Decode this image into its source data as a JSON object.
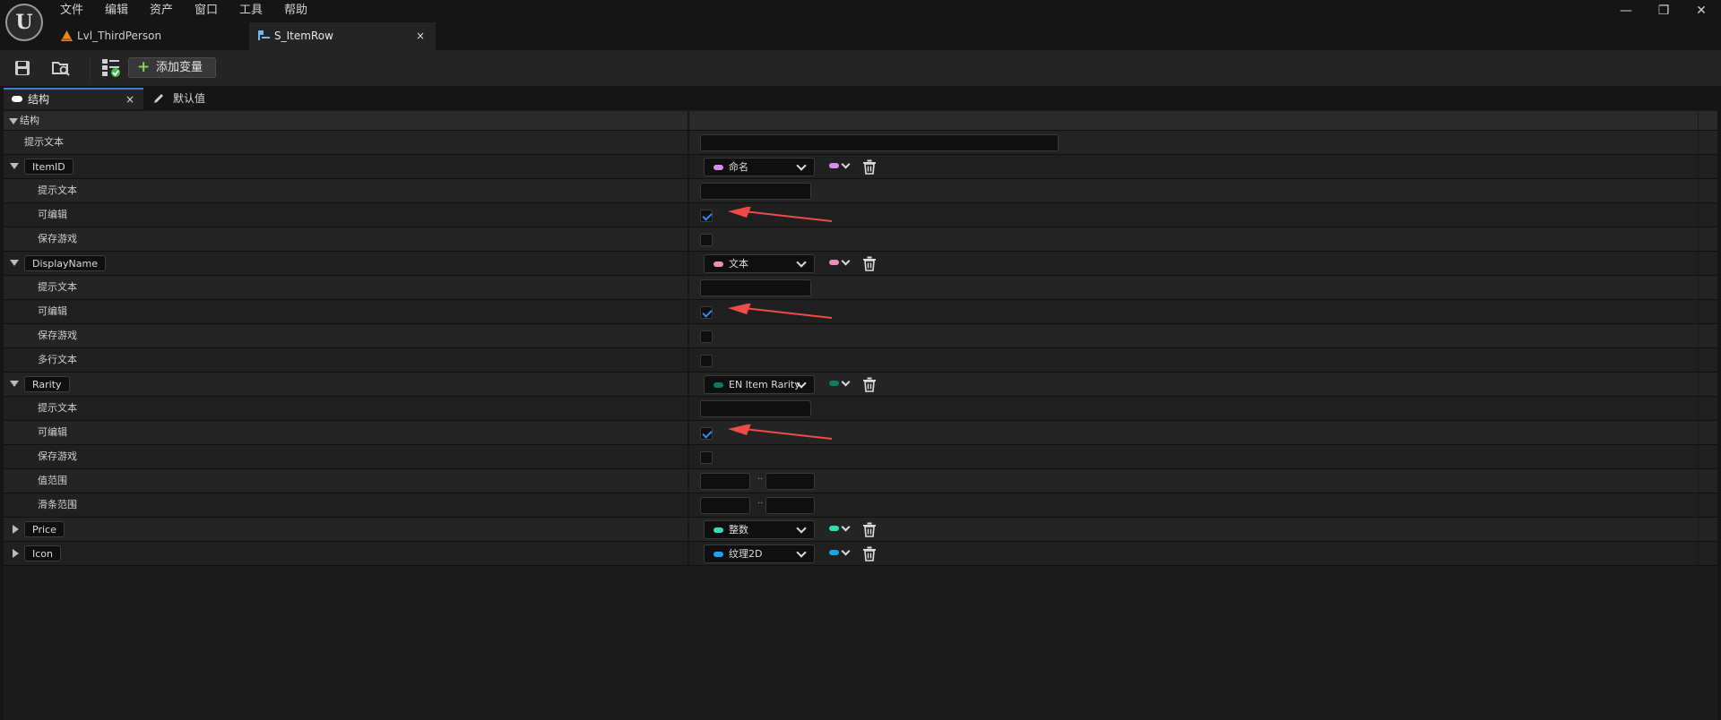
{
  "app": {
    "logo": "U"
  },
  "menu": [
    "文件",
    "编辑",
    "资产",
    "窗口",
    "工具",
    "帮助"
  ],
  "window_controls": {
    "minimize": "—",
    "restore": "❐",
    "close": "✕"
  },
  "doc_tabs": [
    {
      "label": "Lvl_ThirdPerson",
      "icon": "level-icon",
      "active": false
    },
    {
      "label": "S_ItemRow",
      "icon": "struct-icon",
      "active": true,
      "close": "×"
    }
  ],
  "toolbar": {
    "add_variable_label": "添加变量"
  },
  "panel_tabs": [
    {
      "label": "结构",
      "active": true,
      "close": "×"
    },
    {
      "label": "默认值",
      "active": false
    }
  ],
  "structure": {
    "section_label": "结构",
    "tooltip_label": "提示文本",
    "members": [
      {
        "name": "ItemID",
        "type": "命名",
        "color": "#d88ef0",
        "expanded": true,
        "properties": [
          {
            "label": "提示文本",
            "kind": "text"
          },
          {
            "label": "可编辑",
            "kind": "checkbox",
            "checked": true,
            "annotated": true
          },
          {
            "label": "保存游戏",
            "kind": "checkbox",
            "checked": false
          }
        ]
      },
      {
        "name": "DisplayName",
        "type": "文本",
        "color": "#ef8fb7",
        "expanded": true,
        "properties": [
          {
            "label": "提示文本",
            "kind": "text"
          },
          {
            "label": "可编辑",
            "kind": "checkbox",
            "checked": true,
            "annotated": true
          },
          {
            "label": "保存游戏",
            "kind": "checkbox",
            "checked": false
          },
          {
            "label": "多行文本",
            "kind": "checkbox",
            "checked": false
          }
        ]
      },
      {
        "name": "Rarity",
        "type": "EN Item Rarity",
        "color": "#0e7a63",
        "expanded": true,
        "properties": [
          {
            "label": "提示文本",
            "kind": "text"
          },
          {
            "label": "可编辑",
            "kind": "checkbox",
            "checked": true,
            "annotated": true
          },
          {
            "label": "保存游戏",
            "kind": "checkbox",
            "checked": false
          },
          {
            "label": "值范围",
            "kind": "range",
            "separator": ".."
          },
          {
            "label": "滑条范围",
            "kind": "range",
            "separator": ".."
          }
        ]
      },
      {
        "name": "Price",
        "type": "整数",
        "color": "#2ee0b8",
        "expanded": false,
        "properties": []
      },
      {
        "name": "Icon",
        "type": "纹理2D",
        "color": "#1ba3ee",
        "expanded": false,
        "properties": []
      }
    ]
  },
  "annotation_color": "#ef4b4b"
}
